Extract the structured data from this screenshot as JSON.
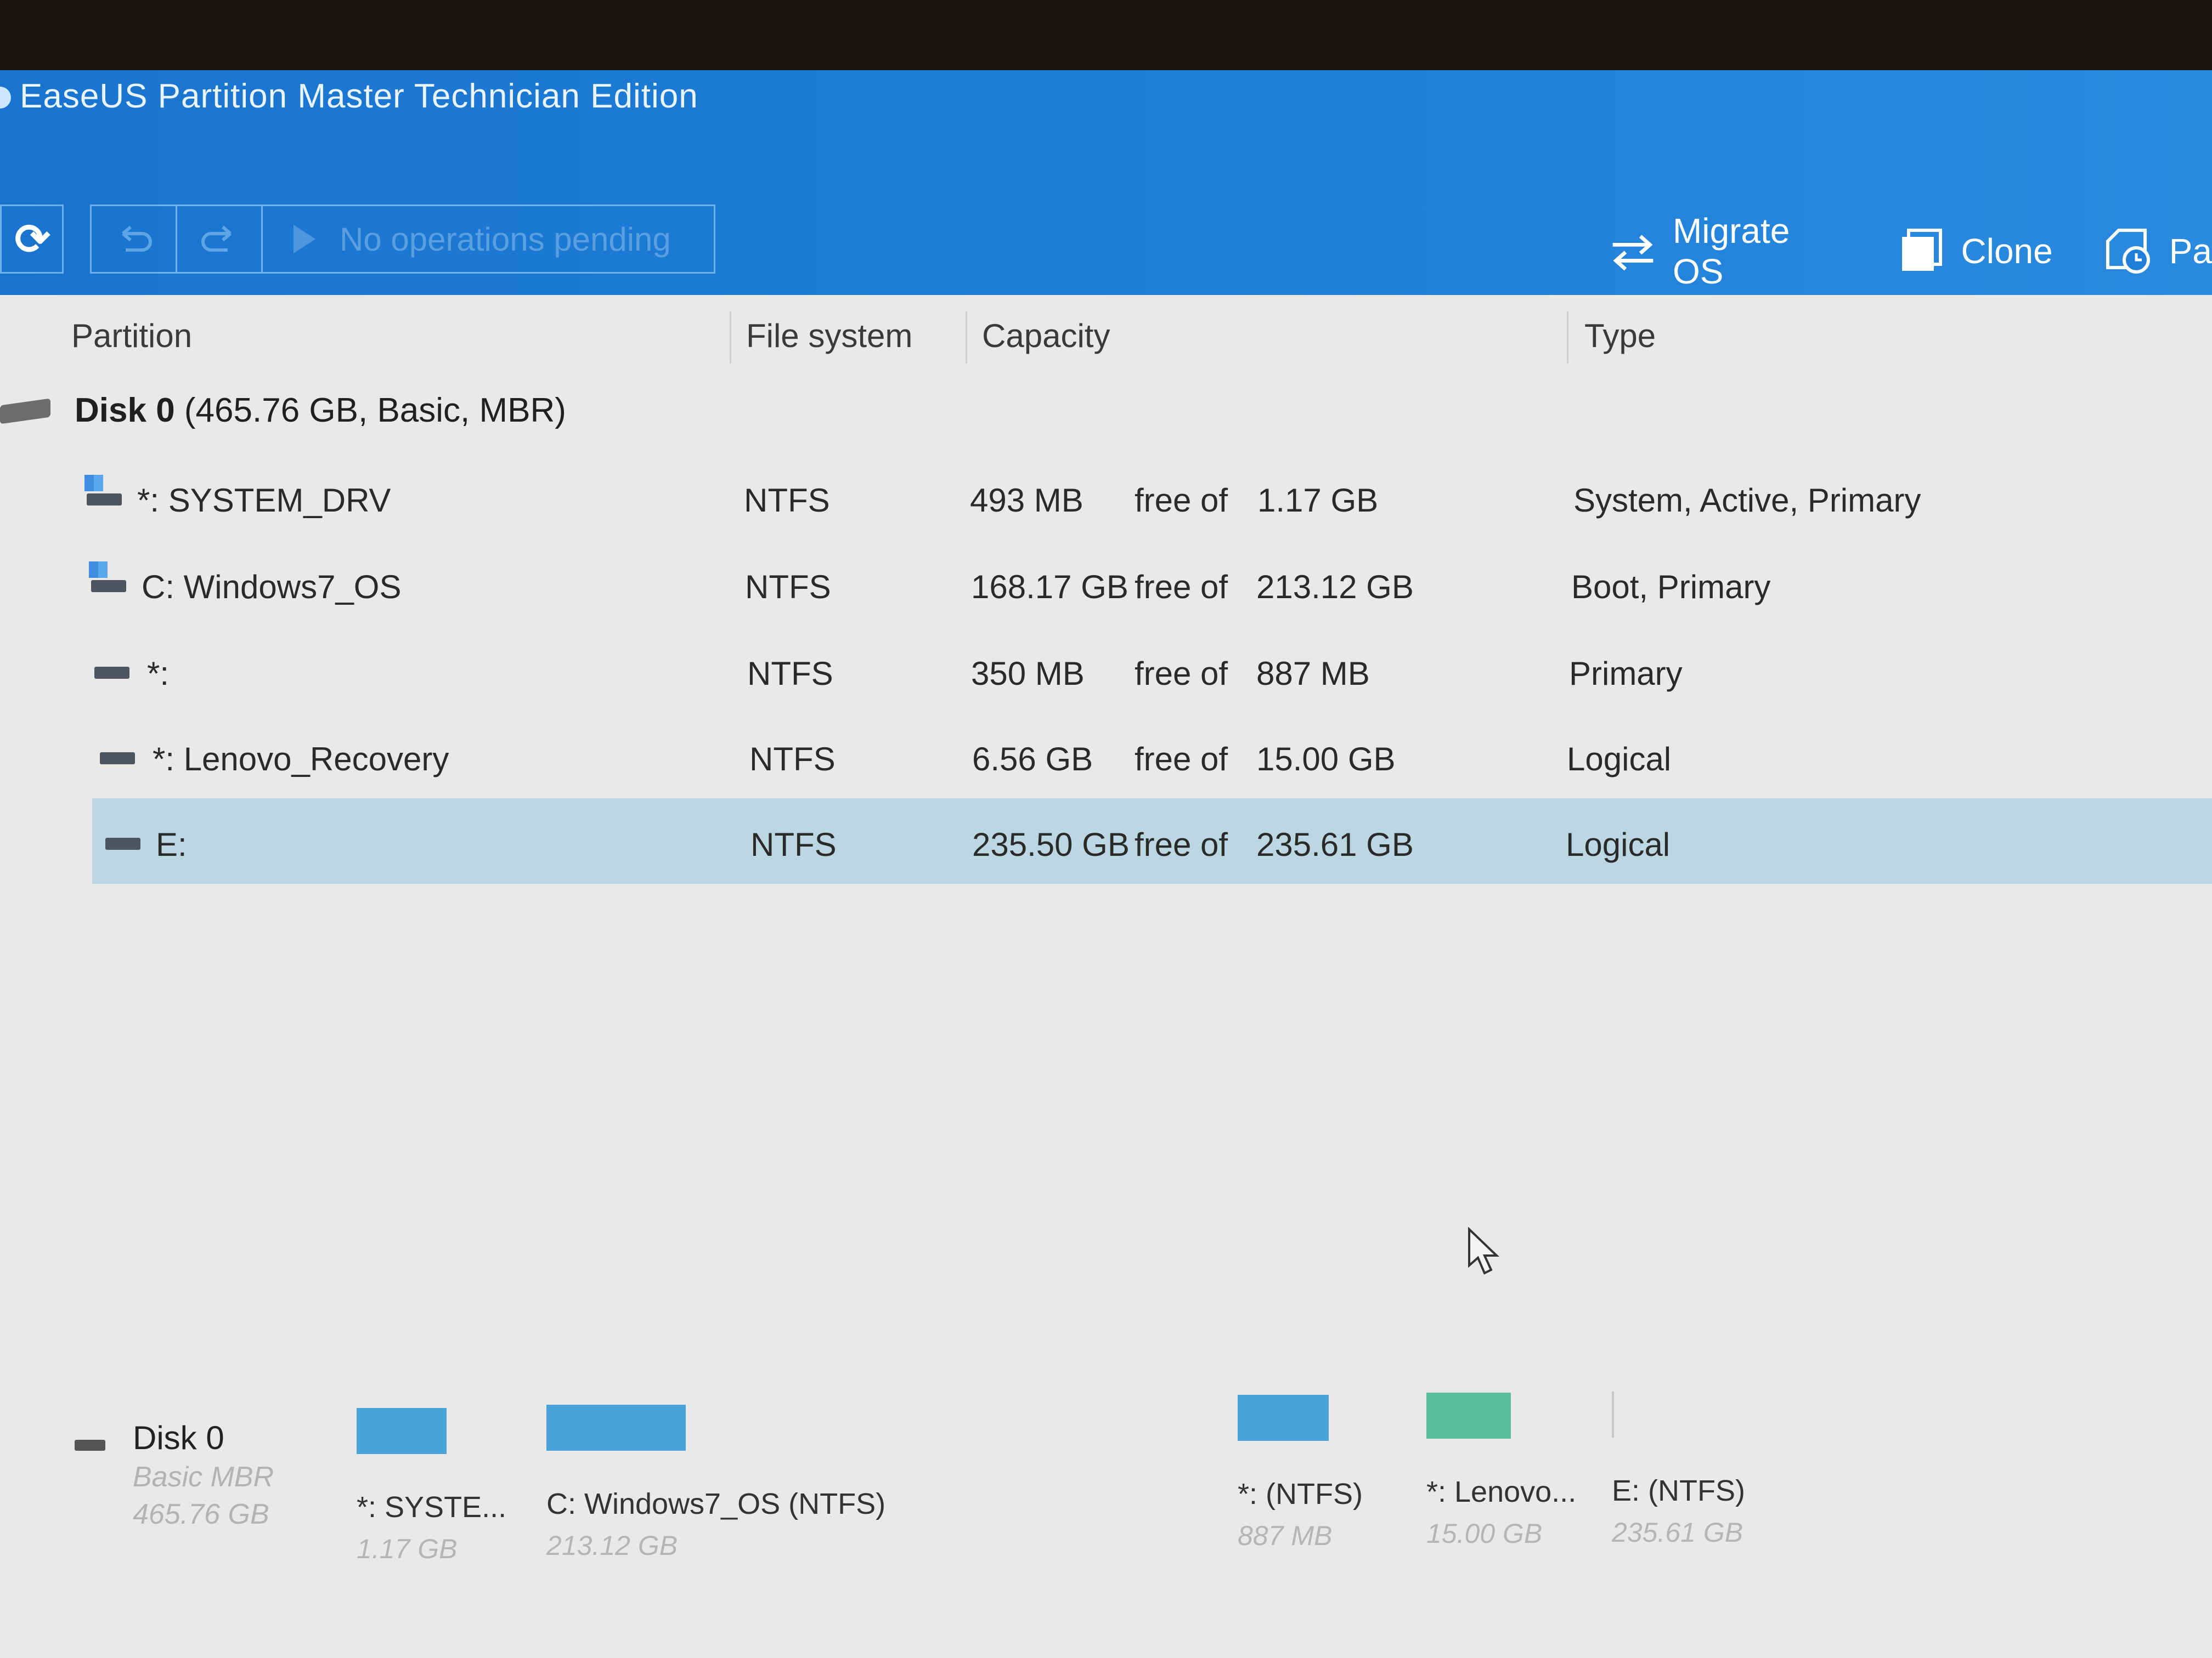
{
  "app": {
    "title": "EaseUS Partition Master Technician Edition"
  },
  "toolbar": {
    "pending_label": "No operations pending",
    "tools": [
      {
        "label": "Migrate OS",
        "icon": "migrate-icon"
      },
      {
        "label": "Clone",
        "icon": "clone-icon"
      },
      {
        "label": "Pa",
        "icon": "partition-recovery-icon"
      }
    ]
  },
  "table": {
    "columns": [
      "Partition",
      "File system",
      "Capacity",
      "Type"
    ],
    "disk": {
      "name": "Disk 0",
      "details": "(465.76 GB, Basic, MBR)"
    },
    "rows": [
      {
        "partition": "*: SYSTEM_DRV",
        "fs": "NTFS",
        "free": "493 MB",
        "of": "free of",
        "total": "1.17 GB",
        "type": "System, Active, Primary",
        "icon": "windows-drive-icon"
      },
      {
        "partition": "C: Windows7_OS",
        "fs": "NTFS",
        "free": "168.17 GB",
        "of": "free of",
        "total": "213.12 GB",
        "type": "Boot, Primary",
        "icon": "windows-drive-icon"
      },
      {
        "partition": "*:",
        "fs": "NTFS",
        "free": "350 MB",
        "of": "free of",
        "total": "887 MB",
        "type": "Primary",
        "icon": "drive-icon"
      },
      {
        "partition": "*: Lenovo_Recovery",
        "fs": "NTFS",
        "free": "6.56 GB",
        "of": "free of",
        "total": "15.00 GB",
        "type": "Logical",
        "icon": "drive-icon"
      },
      {
        "partition": "E:",
        "fs": "NTFS",
        "free": "235.50 GB",
        "of": "free of",
        "total": "235.61 GB",
        "type": "Logical",
        "icon": "drive-icon",
        "selected": true
      }
    ]
  },
  "diskmap": {
    "disk_name": "Disk 0",
    "disk_type": "Basic MBR",
    "disk_size": "465.76 GB",
    "partitions": [
      {
        "label": "*: SYSTE...",
        "size": "1.17 GB",
        "color": "#4aa3d8"
      },
      {
        "label": "C: Windows7_OS (NTFS)",
        "size": "213.12 GB",
        "color": "#4aa3d8"
      },
      {
        "label": "*: (NTFS)",
        "size": "887 MB",
        "color": "#4aa3d8"
      },
      {
        "label": "*: Lenovo...",
        "size": "15.00 GB",
        "color": "#5cbf9c"
      },
      {
        "label": "E: (NTFS)",
        "size": "235.61 GB",
        "color": "#4aa3d8"
      }
    ]
  },
  "colors": {
    "titlebar": "#1a74cf",
    "selected_row": "#bcd6e2"
  }
}
